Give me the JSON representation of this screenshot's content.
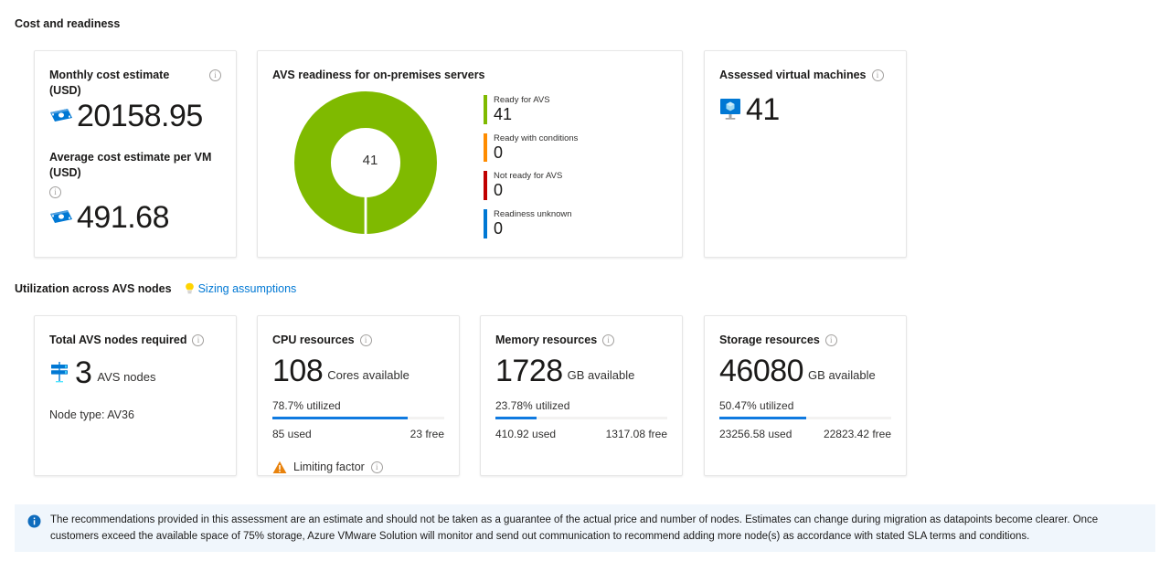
{
  "sections": {
    "cost_readiness": {
      "title": "Cost and readiness"
    },
    "utilization": {
      "title": "Utilization across AVS nodes",
      "link_label": "Sizing assumptions",
      "link_icon": "lightbulb-icon"
    }
  },
  "cards": {
    "cost": {
      "monthly": {
        "title": "Monthly cost estimate (USD)",
        "value": "20158.95",
        "icon": "money-icon",
        "info_icon": "info-icon"
      },
      "average": {
        "title": "Average cost estimate per VM (USD)",
        "value": "491.68",
        "icon": "money-icon",
        "info_icon": "info-icon"
      }
    },
    "readiness": {
      "title": "AVS readiness for on-premises servers",
      "center_value": "41"
    },
    "assessed_vms": {
      "title": "Assessed virtual machines",
      "value": "41",
      "icon": "virtual-machine-icon",
      "info_icon": "info-icon"
    },
    "nodes": {
      "title": "Total AVS nodes required",
      "value": "3",
      "unit": "AVS nodes",
      "node_type": "Node type: AV36",
      "icon": "avs-node-icon",
      "info_icon": "info-icon"
    },
    "cpu": {
      "title": "CPU resources",
      "value": "108",
      "unit": "Cores available",
      "utilized": "78.7% utilized",
      "used": "85 used",
      "free": "23 free",
      "limiting_factor": "Limiting factor",
      "warning_icon": "warning-icon",
      "info_icon": "info-icon"
    },
    "memory": {
      "title": "Memory resources",
      "value": "1728",
      "unit": "GB available",
      "utilized": "23.78% utilized",
      "used": "410.92 used",
      "free": "1317.08 free",
      "info_icon": "info-icon"
    },
    "storage": {
      "title": "Storage resources",
      "value": "46080",
      "unit": "GB available",
      "utilized": "50.47% utilized",
      "used": "23256.58 used",
      "free": "22823.42 free",
      "info_icon": "info-icon"
    }
  },
  "banner": {
    "icon": "info-filled-icon",
    "text": "The recommendations provided in this assessment are an estimate and should not be taken as a guarantee of the actual price and number of nodes. Estimates can change during migration as datapoints become clearer. Once customers exceed the available space of 75% storage, Azure VMware Solution will monitor and send out communication to recommend adding more node(s) as accordance with stated SLA terms and conditions."
  },
  "colors": {
    "ready": "#7FBA00",
    "conditions": "#FF8C00",
    "not_ready": "#C00000",
    "unknown": "#0078D4",
    "bar_fill": "#0F7AE0",
    "link": "#0078D4",
    "banner_bg": "#F0F6FC"
  },
  "chart_data": {
    "type": "pie",
    "title": "AVS readiness for on-premises servers",
    "center_label": "41",
    "legend_position": "right",
    "categories": [
      "Ready for AVS",
      "Ready with conditions",
      "Not ready for AVS",
      "Readiness unknown"
    ],
    "values": [
      41,
      0,
      0,
      0
    ],
    "colors": [
      "#7FBA00",
      "#FF8C00",
      "#C00000",
      "#0078D4"
    ],
    "total": 41
  },
  "utilization_bars": [
    {
      "name": "CPU",
      "percent": 78.7,
      "used": 85,
      "free": 23,
      "total": 108,
      "unit": "Cores"
    },
    {
      "name": "Memory",
      "percent": 23.78,
      "used": 410.92,
      "free": 1317.08,
      "total": 1728,
      "unit": "GB"
    },
    {
      "name": "Storage",
      "percent": 50.47,
      "used": 23256.58,
      "free": 22823.42,
      "total": 46080,
      "unit": "GB"
    }
  ]
}
